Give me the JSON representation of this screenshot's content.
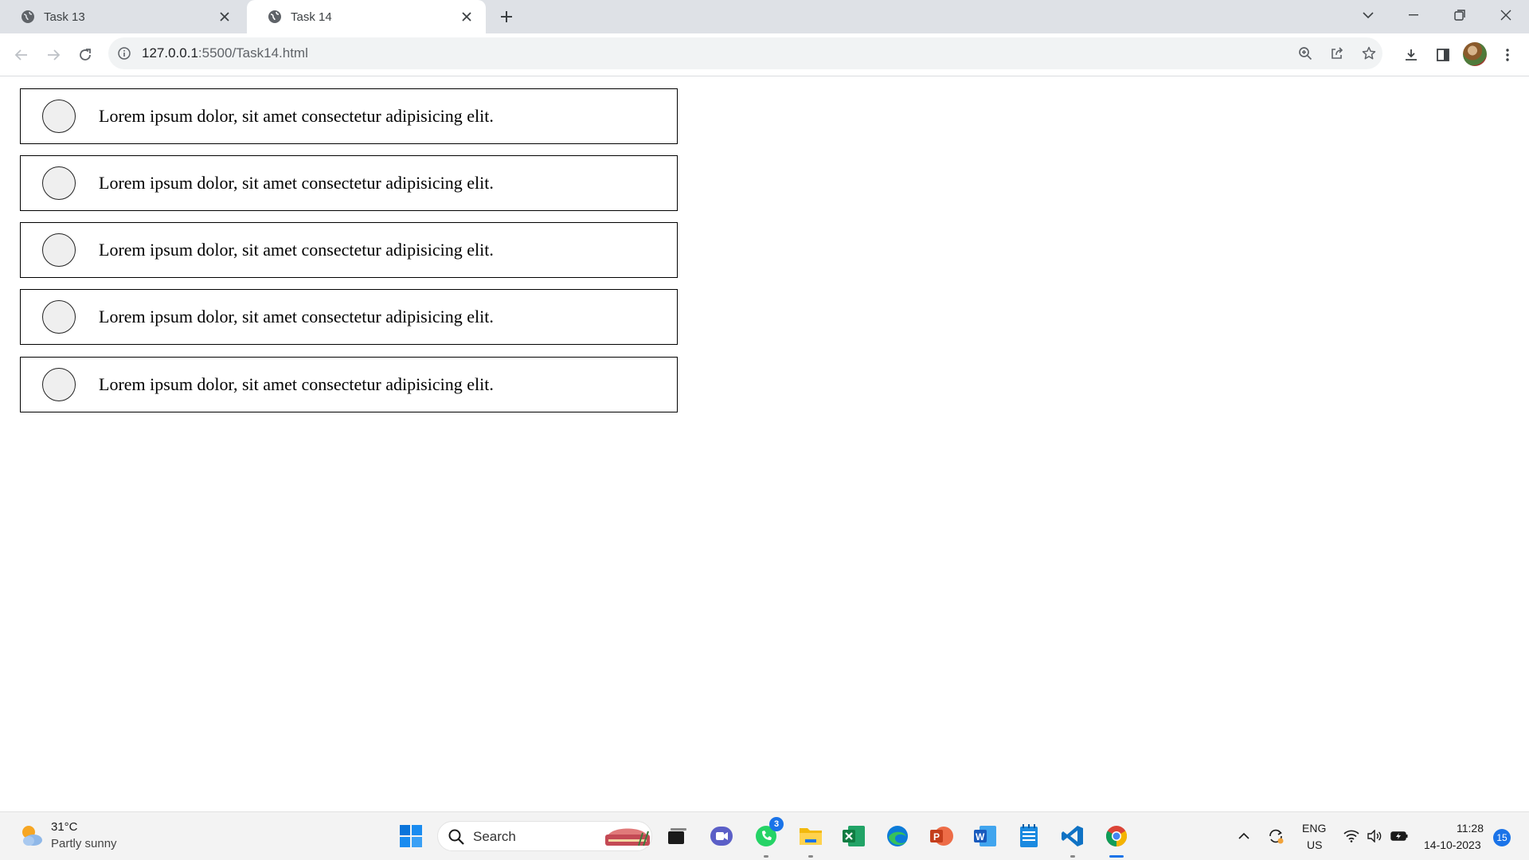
{
  "browser": {
    "tabs": [
      {
        "title": "Task 13",
        "active": false,
        "icon": "globe-icon"
      },
      {
        "title": "Task 14",
        "active": true,
        "icon": "globe-icon"
      }
    ],
    "url_host": "127.0.0.1",
    "url_rest": ":5500/Task14.html"
  },
  "page": {
    "items": [
      {
        "text": "Lorem ipsum dolor, sit amet consectetur adipisicing elit."
      },
      {
        "text": "Lorem ipsum dolor, sit amet consectetur adipisicing elit."
      },
      {
        "text": "Lorem ipsum dolor, sit amet consectetur adipisicing elit."
      },
      {
        "text": "Lorem ipsum dolor, sit amet consectetur adipisicing elit."
      },
      {
        "text": "Lorem ipsum dolor, sit amet consectetur adipisicing elit."
      }
    ]
  },
  "taskbar": {
    "weather_temp": "31°C",
    "weather_condition": "Partly sunny",
    "search_placeholder": "Search",
    "whatsapp_badge": "3",
    "language": "ENG",
    "region": "US",
    "time": "11:28",
    "date": "14-10-2023",
    "notification_count": "15"
  },
  "colors": {
    "tabstrip": "#dee1e6",
    "accent": "#1a73e8",
    "item_border": "#000000",
    "radio_fill": "#efefef"
  }
}
